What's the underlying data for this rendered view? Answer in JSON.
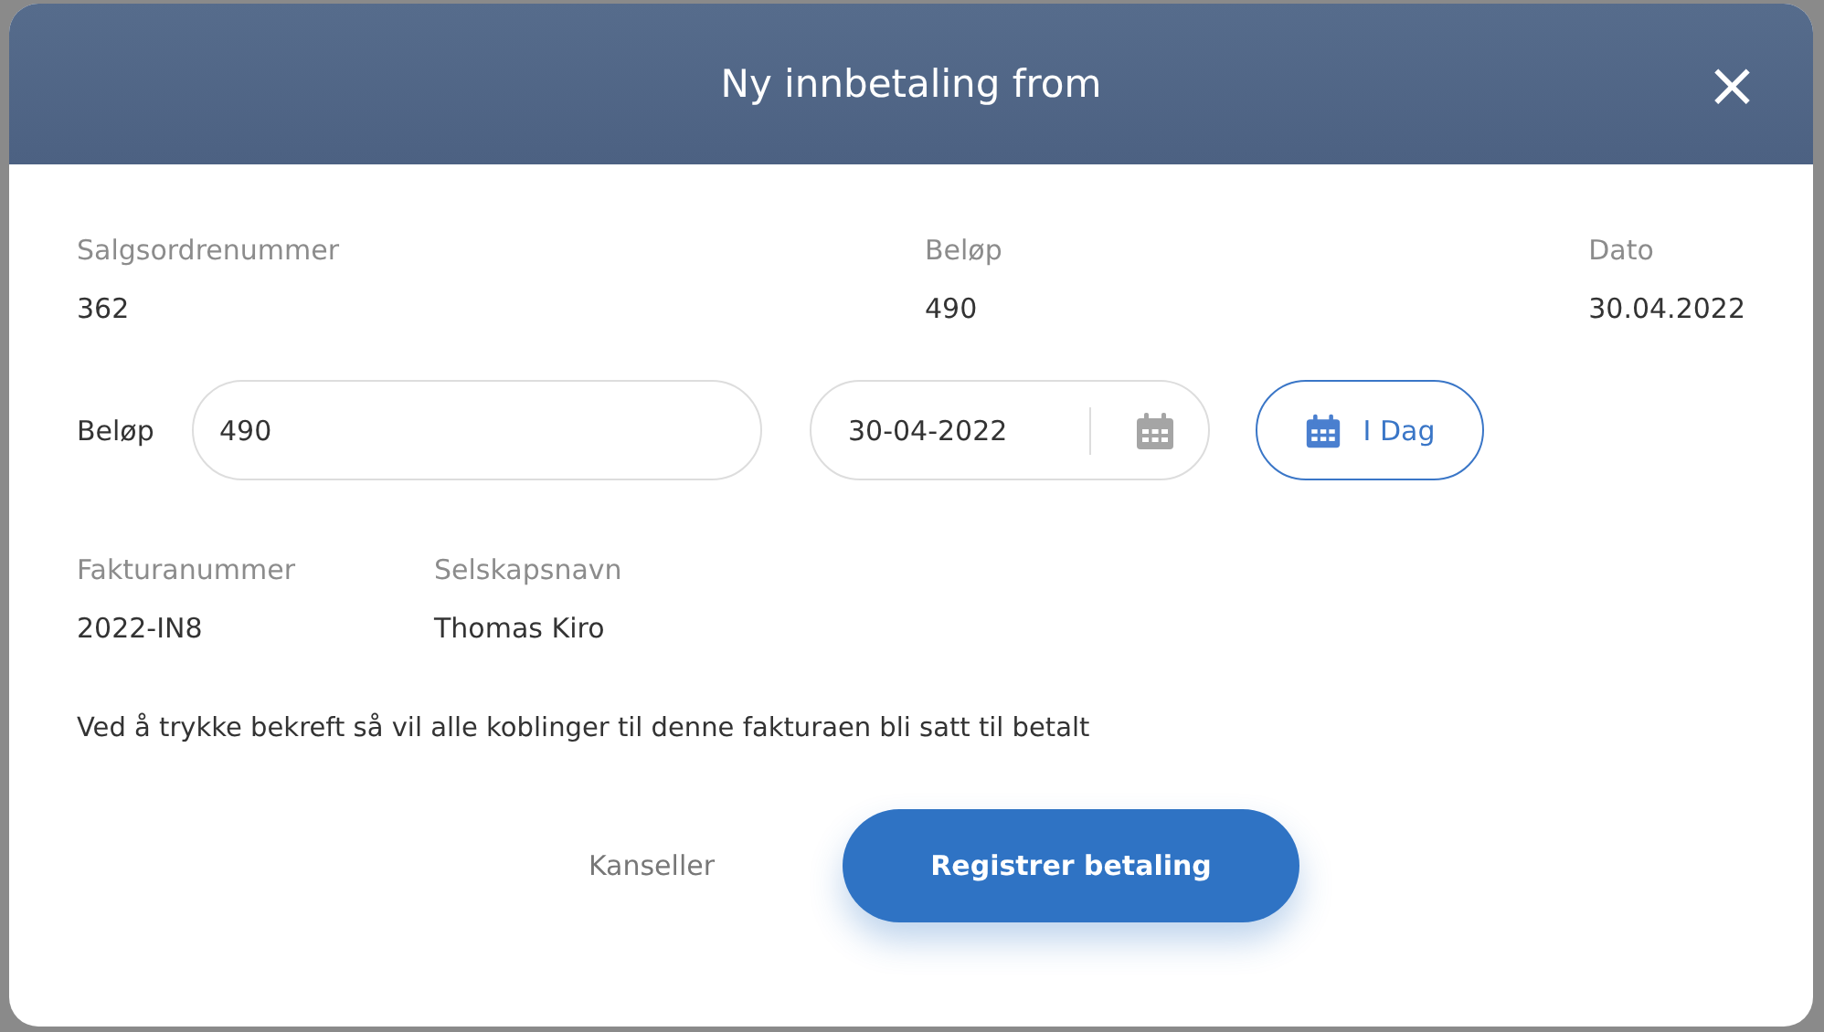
{
  "dialog": {
    "title": "Ny innbetaling from",
    "close": "×"
  },
  "summary": [
    {
      "label": "Salgsordrenummer",
      "value": "362"
    },
    {
      "label": "Beløp",
      "value": "490"
    },
    {
      "label": "Dato",
      "value": "30.04.2022"
    }
  ],
  "amount_field": {
    "label": "Beløp",
    "value": "490"
  },
  "date_field": {
    "value": "30-04-2022"
  },
  "today_button": {
    "label": "I Dag"
  },
  "details": [
    {
      "label": "Fakturanummer",
      "value": "2022-IN8"
    },
    {
      "label": "Selskapsnavn",
      "value": "Thomas Kiro"
    }
  ],
  "notice": "Ved å trykke bekreft så vil alle koblinger til denne fakturaen bli satt til betalt",
  "buttons": [
    {
      "label": "Kanseller",
      "kind": "secondary"
    },
    {
      "label": "Registrer betaling",
      "kind": "primary"
    }
  ]
}
